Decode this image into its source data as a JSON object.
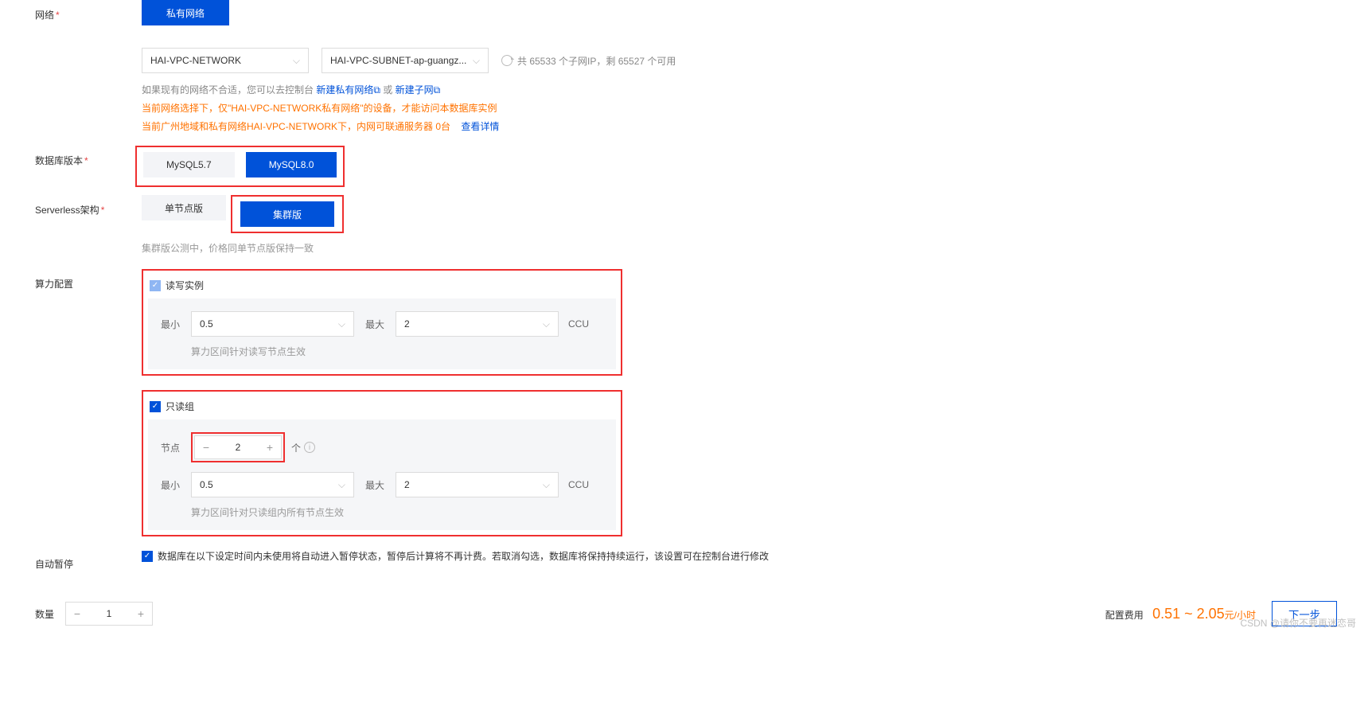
{
  "network": {
    "label": "网络",
    "tab_private": "私有网络",
    "vpc_select": "HAI-VPC-NETWORK",
    "subnet_select": "HAI-VPC-SUBNET-ap-guangz...",
    "subnet_info": "共 65533 个子网IP，剩 65527 个可用",
    "helper_prefix": "如果现有的网络不合适，您可以去控制台 ",
    "link_vpc": "新建私有网络",
    "helper_or": " 或 ",
    "link_subnet": "新建子网",
    "ext_icon": "⧉",
    "warn1": "当前网络选择下，仅\"HAI-VPC-NETWORK私有网络\"的设备，才能访问本数据库实例",
    "warn2_prefix": "当前广州地域和私有网络HAI-VPC-NETWORK下，内网可联通服务器 ",
    "warn2_count": "0台",
    "warn2_link": "查看详情"
  },
  "db_version": {
    "label": "数据库版本",
    "opt1": "MySQL5.7",
    "opt2": "MySQL8.0"
  },
  "serverless": {
    "label": "Serverless架构",
    "opt1": "单节点版",
    "opt2": "集群版",
    "tip": "集群版公测中，价格同单节点版保持一致"
  },
  "compute": {
    "label": "算力配置",
    "rw_title": "读写实例",
    "ro_title": "只读组",
    "min_label": "最小",
    "max_label": "最大",
    "min_val": "0.5",
    "max_val": "2",
    "unit": "CCU",
    "rw_tip": "算力区间针对读写节点生效",
    "node_label": "节点",
    "node_val": "2",
    "node_unit": "个",
    "ro_min_val": "0.5",
    "ro_max_val": "2",
    "ro_tip": "算力区间针对只读组内所有节点生效"
  },
  "auto_pause": {
    "label": "自动暂停",
    "text": "数据库在以下设定时间内未使用将自动进入暂停状态，暂停后计算将不再计费。若取消勾选，数据库将保持持续运行，该设置可在控制台进行修改"
  },
  "footer": {
    "qty_label": "数量",
    "qty_val": "1",
    "cost_label": "配置费用",
    "price": "0.51 ~ 2.05",
    "price_unit": "元/小时",
    "next": "下一步"
  },
  "watermark": "CSDN @请你不要再迷恋哥"
}
